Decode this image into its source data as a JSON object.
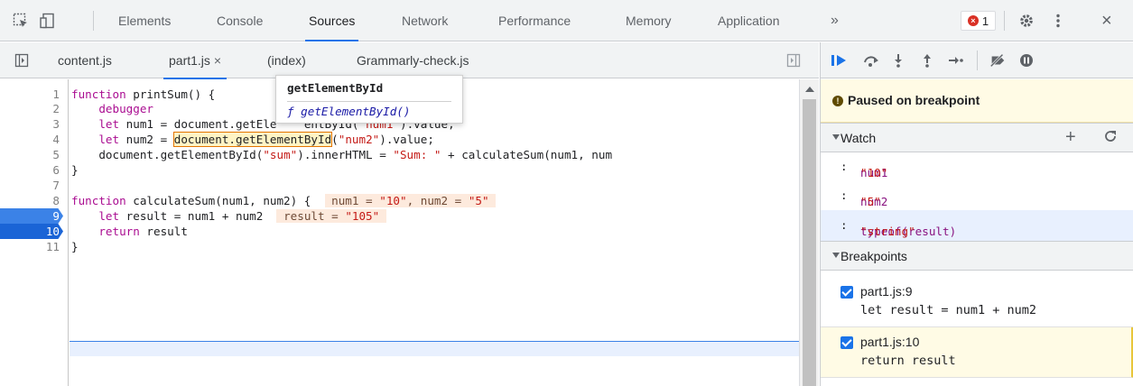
{
  "toolbar": {
    "tabs": [
      "Elements",
      "Console",
      "Sources",
      "Network",
      "Performance",
      "Memory",
      "Application"
    ],
    "active_tab": "Sources",
    "more_label": "»",
    "error_count": "1",
    "close_label": "×"
  },
  "files": {
    "tabs": [
      {
        "label": "content.js"
      },
      {
        "label": "part1.js",
        "close": "×",
        "active": true
      },
      {
        "label": "(index)"
      },
      {
        "label": "Grammarly-check.js"
      }
    ]
  },
  "editor": {
    "line_numbers": [
      "1",
      "2",
      "3",
      "4",
      "5",
      "6",
      "7",
      "8",
      "9",
      "10",
      "11"
    ],
    "breakpoint_lines": [
      "9",
      "10"
    ],
    "lines": [
      "function printSum() {",
      "    debugger",
      "    let num1 = document.getElementById(\"num1\").value;",
      "    let num2 = document.getElementById(\"num2\").value;",
      "    document.getElementById(\"sum\").innerHTML = \"Sum: \" + calculateSum(num1, num",
      "}",
      "",
      "function calculateSum(num1, num2) {",
      "    let result = num1 + num2",
      "    return result",
      "}"
    ],
    "line3_visible": {
      "pre": "    let num1 = document.getEle",
      "post": "entById(\"num1\").value;"
    },
    "inline_values": {
      "line8": "num1 = \"10\", num2 = \"5\"",
      "line9": "result = \"105\""
    },
    "autocomplete": {
      "title": "getElementById",
      "signature": "ƒ getElementById()"
    }
  },
  "debugger": {
    "paused_message": "Paused on breakpoint",
    "watch": {
      "title": "Watch",
      "add_label": "+",
      "refresh_label": "C",
      "items": [
        {
          "name": "num1",
          "value": "\"10\""
        },
        {
          "name": "num2",
          "value": "\"5\""
        },
        {
          "name": "typeof(result)",
          "value": "\"string\""
        }
      ]
    },
    "breakpoints": {
      "title": "Breakpoints",
      "items": [
        {
          "file": "part1.js:9",
          "code": "let result = num1 + num2"
        },
        {
          "file": "part1.js:10",
          "code": "return result"
        }
      ]
    }
  }
}
